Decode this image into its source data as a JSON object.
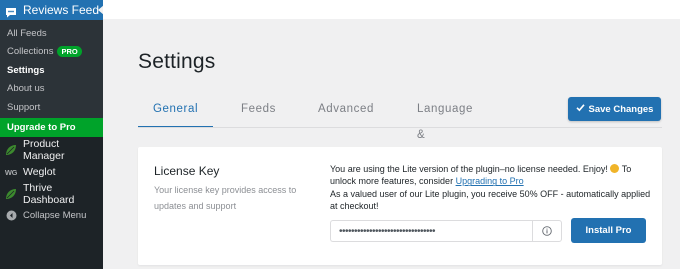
{
  "sidebar": {
    "header_label": "Reviews Feed",
    "submenu": [
      {
        "label": "All Feeds"
      },
      {
        "label": "Collections",
        "badge": "PRO"
      },
      {
        "label": "Settings"
      },
      {
        "label": "About us"
      },
      {
        "label": "Support"
      },
      {
        "label": "Upgrade to Pro"
      }
    ],
    "menu": [
      {
        "label": "Product Manager",
        "icon": "leaf-icon"
      },
      {
        "label": "Weglot",
        "icon": "weglot-logo",
        "icon_text": "WG"
      },
      {
        "label": "Thrive Dashboard",
        "icon": "leaf-icon"
      },
      {
        "label": "Collapse Menu",
        "icon": "collapse-icon"
      }
    ]
  },
  "page": {
    "title": "Settings"
  },
  "tabs": [
    {
      "label": "General"
    },
    {
      "label": "Feeds"
    },
    {
      "label": "Advanced"
    },
    {
      "label": "Language & Translation"
    }
  ],
  "save_button": {
    "label": "Save Changes"
  },
  "license": {
    "title": "License Key",
    "description": "Your license key provides access to updates and support",
    "notice_line1": "You are using the Lite version of the plugin–no license needed. Enjoy!",
    "notice_line2_prefix": "To unlock more features, consider",
    "notice_link": "Upgrading to Pro",
    "notice_line3": "As a valued user of our Lite plugin, you receive 50% OFF - automatically applied at checkout!",
    "input_value": "••••••••••••••••••••••••••••••••",
    "install_label": "Install Pro"
  },
  "colors": {
    "accent": "#2271b1",
    "success": "#00a32a",
    "sidebar_bg": "#1d2327"
  }
}
